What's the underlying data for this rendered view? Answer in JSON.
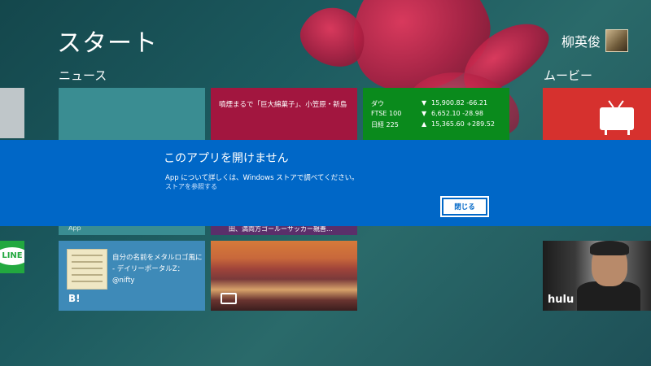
{
  "screen": {
    "title": "スタート"
  },
  "user": {
    "name": "柳英俊"
  },
  "groups": {
    "news": "ニュース",
    "movies": "ムービー"
  },
  "tiles": {
    "news_headline": "噴煙まるで「巨大綿菓子」、小笠原・新島",
    "finance": [
      {
        "name": "ダウ",
        "arrow": "▼",
        "value": "15,900.82 -66.21"
      },
      {
        "name": "FTSE 100",
        "arrow": "▼",
        "value": "6,652.10 -28.98"
      },
      {
        "name": "日経 225",
        "arrow": "▲",
        "value": "15,365.60 +289.52"
      }
    ],
    "app_label": "App",
    "sports_headline": "田、満両方ゴールーサッカー親善…",
    "bookmark_text_line1": "自分の名前をメタルロゴ風に",
    "bookmark_text_line2": "- デイリーポータルZ：@nifty",
    "bookmark_badge": "B!",
    "line_label": "LINE",
    "hulu_logo": "hulu"
  },
  "dialog": {
    "title": "このアプリを開けません",
    "message": "App について詳しくは、Windows ストアで調べてください。",
    "store_link": "ストアを参照する",
    "close_button": "閉じる"
  },
  "colors": {
    "dialog_bg": "#0067c7",
    "finance_tile": "#0a8a1c",
    "news_tile": "#a2163f",
    "movie_tile": "#d6312e"
  }
}
